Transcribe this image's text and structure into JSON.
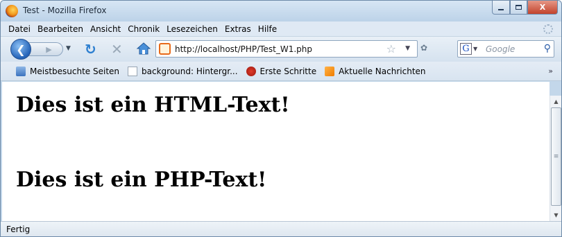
{
  "window": {
    "title": "Test - Mozilla Firefox",
    "min_icon": "minimize-icon",
    "max_icon": "maximize-icon",
    "close_glyph": "X"
  },
  "menu": {
    "items": [
      "Datei",
      "Bearbeiten",
      "Ansicht",
      "Chronik",
      "Lesezeichen",
      "Extras",
      "Hilfe"
    ]
  },
  "nav": {
    "url": "http://localhost/PHP/Test_W1.php",
    "search_placeholder": "Google",
    "icons": [
      "back-icon",
      "forward-icon",
      "reload-icon",
      "stop-icon",
      "home-icon",
      "star-icon",
      "search-icon"
    ]
  },
  "bookmarks": {
    "items": [
      "Meistbesuchte Seiten",
      "background: Hintergr...",
      "Erste Schritte",
      "Aktuelle Nachrichten"
    ],
    "more_glyph": "»"
  },
  "page": {
    "heading1": "Dies ist ein HTML-Text!",
    "heading2": "Dies ist ein PHP-Text!"
  },
  "status": {
    "text": "Fertig"
  },
  "colors": {
    "accent": "#2d7fd0",
    "title_bar": "#c3d7ea"
  }
}
